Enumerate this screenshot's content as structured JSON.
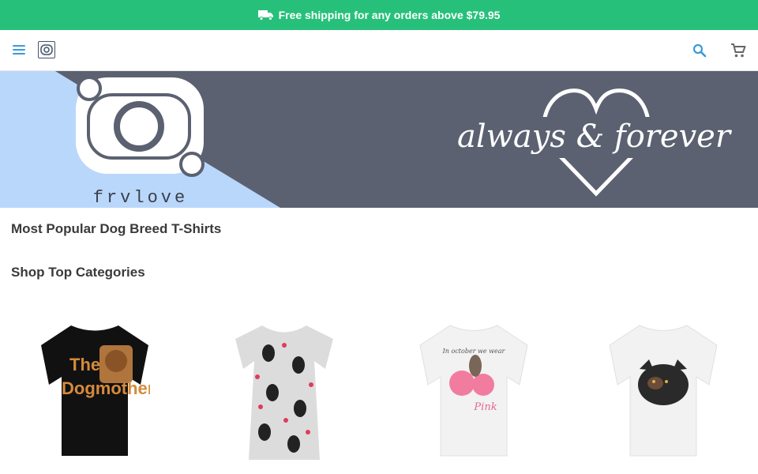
{
  "promo": {
    "text": "Free shipping for any orders above $79.95",
    "icon": "truck-icon",
    "bg_color": "#27c07a"
  },
  "header": {
    "menu_icon": "menu-icon",
    "logo_icon": "frvlove-logo-icon",
    "search_icon": "search-icon",
    "cart_icon": "cart-icon",
    "accent_color": "#3a9bd6"
  },
  "hero": {
    "brand": "frvlove",
    "tagline": "always & forever",
    "bg_left": "#b9d7fb",
    "bg_right": "#5b6171"
  },
  "sections": {
    "popular_title": "Most Popular Dog Breed T-Shirts",
    "categories_title": "Shop Top Categories"
  },
  "products": [
    {
      "name": "the-dogmother-tshirt",
      "shirt_color": "#111111",
      "print_text_1": "The",
      "print_text_2": "Dogmother"
    },
    {
      "name": "penguin-dress",
      "shirt_color": "#dcdcdc"
    },
    {
      "name": "pink-pumpkin-tshirt",
      "shirt_color": "#f2f2f2",
      "print_text_1": "In october we wear",
      "print_text_2": "Pink"
    },
    {
      "name": "cat-tshirt",
      "shirt_color": "#f2f2f2"
    }
  ]
}
